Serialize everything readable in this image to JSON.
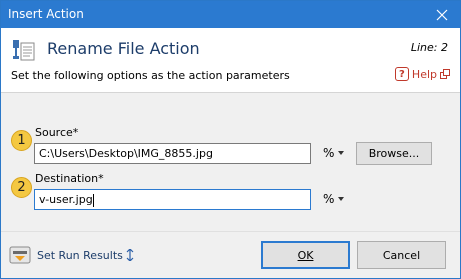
{
  "window": {
    "title": "Insert Action"
  },
  "header": {
    "action_title": "Rename File Action",
    "line_label": "Line: 2",
    "subtitle": "Set the following options as the action parameters",
    "help_label": "Help"
  },
  "fields": {
    "source": {
      "step": "1",
      "label": "Source*",
      "value": "C:\\Users\\Desktop\\IMG_8855.jpg",
      "var_label": "%",
      "browse_label": "Browse..."
    },
    "destination": {
      "step": "2",
      "label": "Destination*",
      "value": "v-user.jpg",
      "var_label": "%"
    }
  },
  "footer": {
    "run_results_label": "Set Run Results",
    "ok_label": "OK",
    "cancel_label": "Cancel"
  },
  "colors": {
    "titlebar": "#2b7ad0",
    "step_badge": "#f4c842",
    "help_accent": "#c0392b"
  }
}
